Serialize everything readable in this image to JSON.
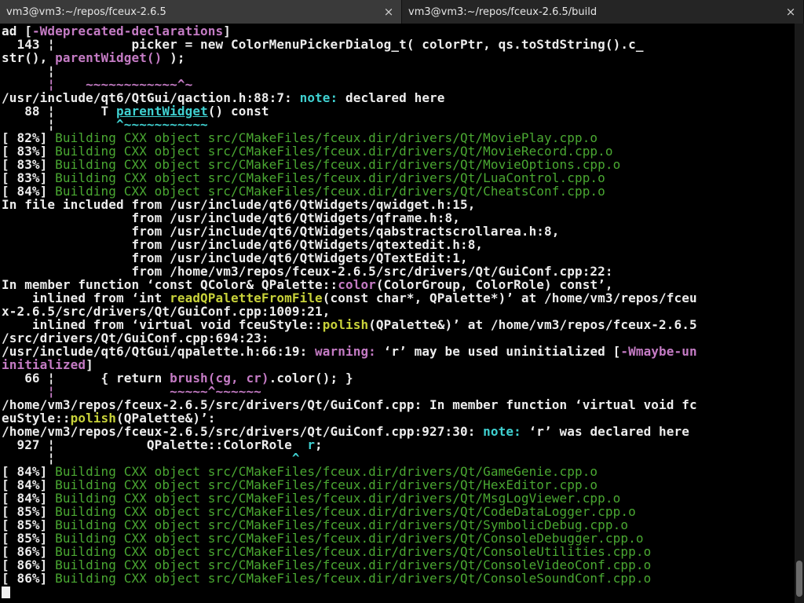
{
  "tabs": [
    {
      "label": "vm3@vm3:~/repos/fceux-2.6.5",
      "close": "×"
    },
    {
      "label": "vm3@vm3:~/repos/fceux-2.6.5/build",
      "close": "×"
    }
  ],
  "terminal": {
    "lines": [
      [
        {
          "t": "ad ["
        },
        {
          "t": "-Wdeprecated-declarations",
          "k": "m"
        },
        {
          "t": "]"
        }
      ],
      [
        {
          "t": "  143 ¦          picker = new ColorMenuPickerDialog_t( colorPtr, qs.toStdString().c_"
        }
      ],
      [
        {
          "t": "str(), "
        },
        {
          "t": "parentWidget()",
          "k": "m"
        },
        {
          "t": " );"
        }
      ],
      [
        {
          "t": "      ¦"
        }
      ],
      [
        {
          "t": "      ¦    ",
          "k": "m"
        },
        {
          "t": "~~~~~~~~~~~~^~",
          "k": "m"
        }
      ],
      [
        {
          "t": "/usr/include/qt6/QtGui/qaction.h:88:7: "
        },
        {
          "t": "note:",
          "k": "c"
        },
        {
          "t": " declared here"
        }
      ],
      [
        {
          "t": "   88 ¦      T "
        },
        {
          "t": "parentWidget",
          "k": "cu"
        },
        {
          "t": "() const"
        }
      ],
      [
        {
          "t": "      ¦        "
        },
        {
          "t": "^~~~~~~~~~~~",
          "k": "c"
        }
      ],
      [
        {
          "t": "[ 82%] "
        },
        {
          "t": "Building CXX object src/CMakeFiles/fceux.dir/drivers/Qt/MoviePlay.cpp.o",
          "k": "g"
        }
      ],
      [
        {
          "t": "[ 83%] "
        },
        {
          "t": "Building CXX object src/CMakeFiles/fceux.dir/drivers/Qt/MovieRecord.cpp.o",
          "k": "g"
        }
      ],
      [
        {
          "t": "[ 83%] "
        },
        {
          "t": "Building CXX object src/CMakeFiles/fceux.dir/drivers/Qt/MovieOptions.cpp.o",
          "k": "g"
        }
      ],
      [
        {
          "t": "[ 83%] "
        },
        {
          "t": "Building CXX object src/CMakeFiles/fceux.dir/drivers/Qt/LuaControl.cpp.o",
          "k": "g"
        }
      ],
      [
        {
          "t": "[ 84%] "
        },
        {
          "t": "Building CXX object src/CMakeFiles/fceux.dir/drivers/Qt/CheatsConf.cpp.o",
          "k": "g"
        }
      ],
      [
        {
          "t": "In file included from /usr/include/qt6/QtWidgets/qwidget.h:15,"
        }
      ],
      [
        {
          "t": "                 from /usr/include/qt6/QtWidgets/qframe.h:8,"
        }
      ],
      [
        {
          "t": "                 from /usr/include/qt6/QtWidgets/qabstractscrollarea.h:8,"
        }
      ],
      [
        {
          "t": "                 from /usr/include/qt6/QtWidgets/qtextedit.h:8,"
        }
      ],
      [
        {
          "t": "                 from /usr/include/qt6/QtWidgets/QTextEdit:1,"
        }
      ],
      [
        {
          "t": "                 from /home/vm3/repos/fceux-2.6.5/src/drivers/Qt/GuiConf.cpp:22:"
        }
      ],
      [
        {
          "t": "In member function ‘const QColor& QPalette::"
        },
        {
          "t": "color",
          "k": "m"
        },
        {
          "t": "(ColorGroup, ColorRole) const’,"
        }
      ],
      [
        {
          "t": "    inlined from ‘int "
        },
        {
          "t": "readQPaletteFromFile",
          "k": "y"
        },
        {
          "t": "(const char*, QPalette*)’ at /home/vm3/repos/fceu"
        }
      ],
      [
        {
          "t": "x-2.6.5/src/drivers/Qt/GuiConf.cpp:1009:21,"
        }
      ],
      [
        {
          "t": "    inlined from ‘virtual void fceuStyle::"
        },
        {
          "t": "polish",
          "k": "y"
        },
        {
          "t": "(QPalette&)’ at /home/vm3/repos/fceux-2.6.5"
        }
      ],
      [
        {
          "t": "/src/drivers/Qt/GuiConf.cpp:694:23:"
        }
      ],
      [
        {
          "t": "/usr/include/qt6/QtGui/qpalette.h:66:19: "
        },
        {
          "t": "warning:",
          "k": "m"
        },
        {
          "t": " ‘r’ may be used uninitialized ["
        },
        {
          "t": "-Wmaybe-un",
          "k": "m"
        }
      ],
      [
        {
          "t": "initialized",
          "k": "m"
        },
        {
          "t": "]"
        }
      ],
      [
        {
          "t": "   66 ¦      { return "
        },
        {
          "t": "brush(cg, cr)",
          "k": "m"
        },
        {
          "t": ".color(); }"
        }
      ],
      [
        {
          "t": "      ¦               ",
          "k": "m"
        },
        {
          "t": "~~~~~^~~~~~~",
          "k": "m"
        }
      ],
      [
        {
          "t": "/home/vm3/repos/fceux-2.6.5/src/drivers/Qt/GuiConf.cpp:"
        },
        {
          "t": " In member function ‘virtual void fc"
        }
      ],
      [
        {
          "t": "euStyle::"
        },
        {
          "t": "polish",
          "k": "y"
        },
        {
          "t": "(QPalette&)’:"
        }
      ],
      [
        {
          "t": "/home/vm3/repos/fceux-2.6.5/src/drivers/Qt/GuiConf.cpp:927:30: "
        },
        {
          "t": "note:",
          "k": "c"
        },
        {
          "t": " ‘r’ was declared here"
        }
      ],
      [
        {
          "t": "  927 ¦            QPalette::ColorRole  "
        },
        {
          "t": "r",
          "k": "c"
        },
        {
          "t": ";"
        }
      ],
      [
        {
          "t": "      ¦                               "
        },
        {
          "t": "^",
          "k": "c"
        }
      ],
      [
        {
          "t": "[ 84%] "
        },
        {
          "t": "Building CXX object src/CMakeFiles/fceux.dir/drivers/Qt/GameGenie.cpp.o",
          "k": "g"
        }
      ],
      [
        {
          "t": "[ 84%] "
        },
        {
          "t": "Building CXX object src/CMakeFiles/fceux.dir/drivers/Qt/HexEditor.cpp.o",
          "k": "g"
        }
      ],
      [
        {
          "t": "[ 84%] "
        },
        {
          "t": "Building CXX object src/CMakeFiles/fceux.dir/drivers/Qt/MsgLogViewer.cpp.o",
          "k": "g"
        }
      ],
      [
        {
          "t": "[ 85%] "
        },
        {
          "t": "Building CXX object src/CMakeFiles/fceux.dir/drivers/Qt/CodeDataLogger.cpp.o",
          "k": "g"
        }
      ],
      [
        {
          "t": "[ 85%] "
        },
        {
          "t": "Building CXX object src/CMakeFiles/fceux.dir/drivers/Qt/SymbolicDebug.cpp.o",
          "k": "g"
        }
      ],
      [
        {
          "t": "[ 85%] "
        },
        {
          "t": "Building CXX object src/CMakeFiles/fceux.dir/drivers/Qt/ConsoleDebugger.cpp.o",
          "k": "g"
        }
      ],
      [
        {
          "t": "[ 86%] "
        },
        {
          "t": "Building CXX object src/CMakeFiles/fceux.dir/drivers/Qt/ConsoleUtilities.cpp.o",
          "k": "g"
        }
      ],
      [
        {
          "t": "[ 86%] "
        },
        {
          "t": "Building CXX object src/CMakeFiles/fceux.dir/drivers/Qt/ConsoleVideoConf.cpp.o",
          "k": "g"
        }
      ],
      [
        {
          "t": "[ 86%] "
        },
        {
          "t": "Building CXX object src/CMakeFiles/fceux.dir/drivers/Qt/ConsoleSoundConf.cpp.o",
          "k": "g"
        }
      ]
    ]
  },
  "colors": {
    "background": "#000000",
    "text": "#ededed",
    "build_green": "#4aa832",
    "note_cyan": "#3fd0d0",
    "warning_magenta": "#c47bc4",
    "function_yellow": "#c8d23a",
    "cursor": "#f2f2f2"
  }
}
